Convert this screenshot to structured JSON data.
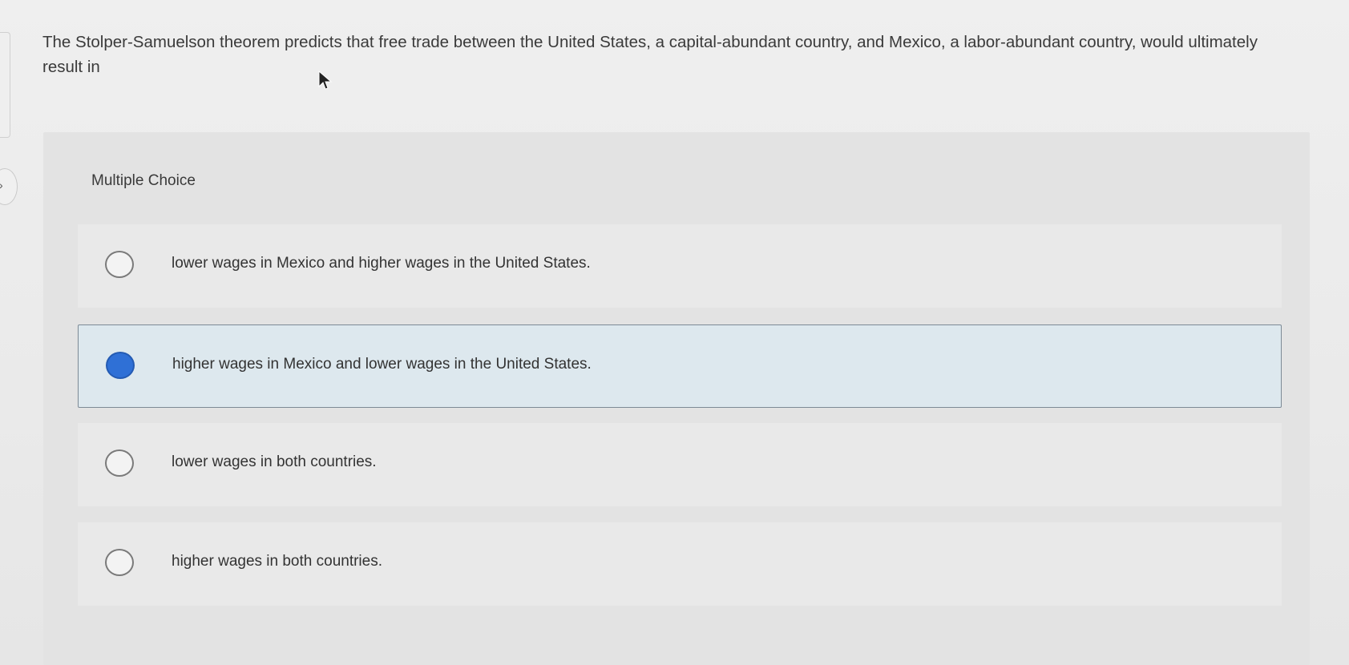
{
  "question": {
    "text": "The Stolper-Samuelson theorem predicts that free trade between the United States, a capital-abundant country, and Mexico, a labor-abundant country, would ultimately result in"
  },
  "multiple_choice": {
    "heading": "Multiple Choice",
    "options": [
      {
        "label": "lower wages in Mexico and higher wages in the United States.",
        "selected": false
      },
      {
        "label": "higher wages in Mexico and lower wages in the United States.",
        "selected": true
      },
      {
        "label": "lower wages in both countries.",
        "selected": false
      },
      {
        "label": "higher wages in both countries.",
        "selected": false
      }
    ]
  },
  "colors": {
    "selected_radio": "#2f70d6",
    "selected_background": "#dde8ee",
    "text": "#333333"
  },
  "icons": {
    "cursor": "mouse-pointer-icon"
  }
}
